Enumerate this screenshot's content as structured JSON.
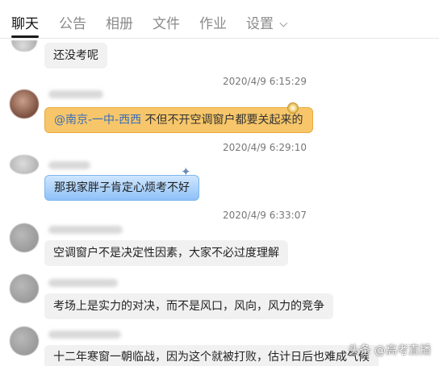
{
  "tabs": [
    {
      "label": "聊天",
      "active": true
    },
    {
      "label": "公告",
      "active": false
    },
    {
      "label": "相册",
      "active": false
    },
    {
      "label": "文件",
      "active": false
    },
    {
      "label": "作业",
      "active": false
    },
    {
      "label": "设置",
      "active": false
    }
  ],
  "messages": [
    {
      "text": "还没考呢"
    },
    {
      "timestamp": "2020/4/9 6:15:29",
      "mention": "@南京-一中-西西",
      "text": "不但不开空调窗户都要关起来的"
    },
    {
      "timestamp": "2020/4/9 6:29:10",
      "text": "那我家胖子肯定心烦考不好"
    },
    {
      "timestamp": "2020/4/9 6:33:07",
      "text": "空调窗户不是决定性因素，大家不必过度理解"
    },
    {
      "text": "考场上是实力的对决，而不是风口，风向，风力的竞争"
    },
    {
      "text": "十二年寒窗一朝临战，因为这个就被打败，估计日后也难成气候"
    }
  ],
  "watermark": "头条 @高考直播",
  "colors": {
    "gold_bubble": "#f7c66a",
    "blue_bubble": "#8ec1f7",
    "grey_bubble": "#f1f1f1",
    "timestamp": "#777777"
  }
}
